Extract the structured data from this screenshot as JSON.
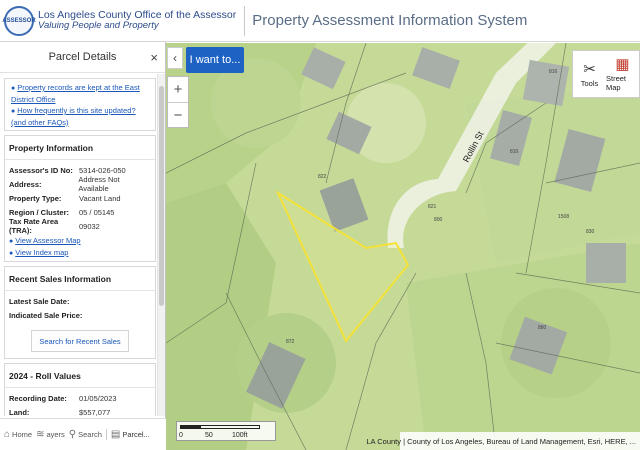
{
  "header": {
    "logo_text": "ASSESSOR",
    "org_name": "Los Angeles County Office of the Assessor",
    "org_tagline": "Valuing People and Property",
    "system_title": "Property Assessment Information System"
  },
  "panel": {
    "title": "Parcel Details",
    "close_label": "×",
    "links": [
      "Property records are kept at the East District Office",
      "How frequently is this site updated?",
      "(and other FAQs)"
    ],
    "property_info": {
      "title": "Property Information",
      "rows": [
        {
          "label": "Assessor's ID No:",
          "value": "5314-026-050"
        },
        {
          "label": "Address:",
          "value": "Address Not Available"
        },
        {
          "label": "Property Type:",
          "value": "Vacant Land"
        },
        {
          "label": "Region / Cluster:",
          "value": "05 / 05145"
        },
        {
          "label": "Tax Rate Area (TRA):",
          "value": "09032"
        }
      ],
      "links": [
        "View Assessor Map",
        "View Index map"
      ]
    },
    "recent_sales": {
      "title": "Recent Sales Information",
      "rows": [
        {
          "label": "Latest Sale Date:",
          "value": ""
        },
        {
          "label": "Indicated Sale Price:",
          "value": ""
        }
      ],
      "button": "Search for Recent Sales"
    },
    "roll_values": {
      "title": "2024 - Roll Values",
      "rows": [
        {
          "label": "Recording Date:",
          "value": "01/05/2023"
        },
        {
          "label": "Land:",
          "value": "$557,077"
        }
      ]
    }
  },
  "bottom_tabs": [
    {
      "icon": "home-icon",
      "label": "Home"
    },
    {
      "icon": "layers-icon",
      "label": "ayers"
    },
    {
      "icon": "search-icon",
      "label": "Search"
    },
    {
      "icon": "parcel-icon",
      "label": "Parcel..."
    }
  ],
  "map": {
    "collapse_label": "‹",
    "i_want_to": "I want to...",
    "zoom_in": "+",
    "zoom_out": "−",
    "street_label": "Rollin St",
    "parcel_numbers": [
      "821",
      "800",
      "810",
      "816",
      "822",
      "1508",
      "872",
      "880",
      "830"
    ],
    "tools": [
      {
        "label": "Tools",
        "icon": "tools-icon"
      },
      {
        "label": "Street Map",
        "icon": "street-map-icon"
      }
    ],
    "scale": {
      "t0": "0",
      "t1": "50",
      "t2": "100ft"
    },
    "attribution": "LA County | County of Los Angeles, Bureau of Land Management, Esri, HERE, ..."
  },
  "colors": {
    "brand_blue": "#1e63c4",
    "parcel_highlight": "#f4e23a"
  }
}
